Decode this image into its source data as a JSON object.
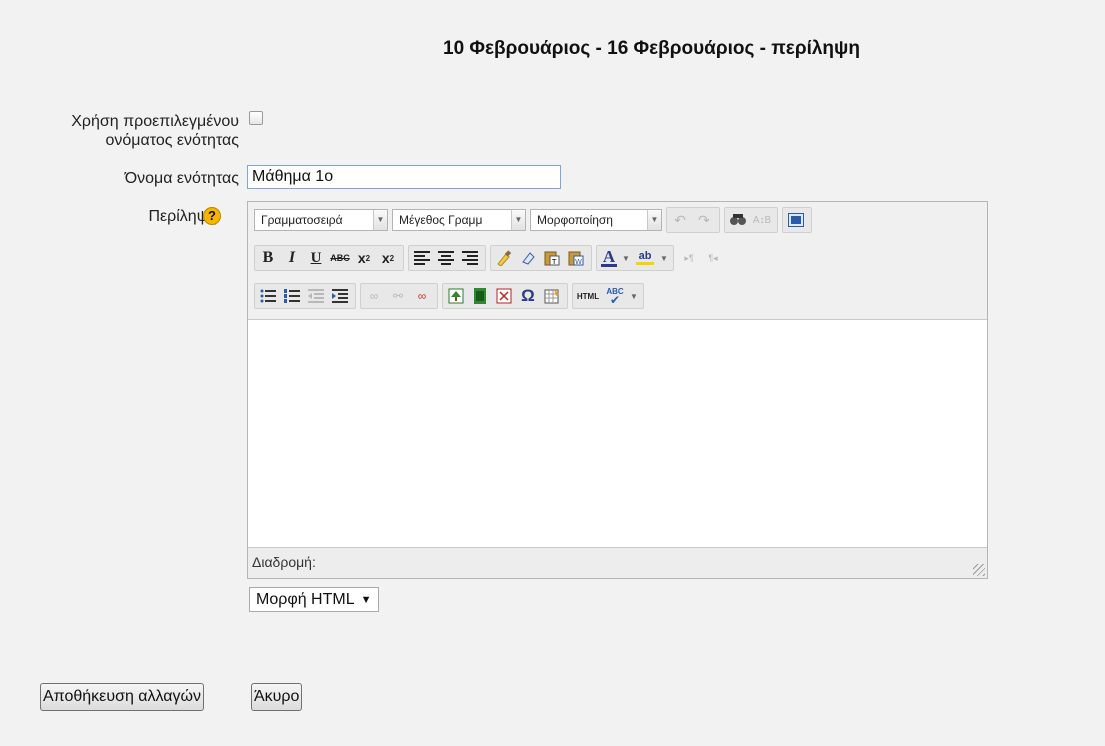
{
  "page": {
    "title": "10 Φεβρουάριος - 16 Φεβρουάριος - περίληψη"
  },
  "form": {
    "use_default_name_label_line1": "Χρήση προεπιλεγμένου",
    "use_default_name_label_line2": "ονόματος ενότητας",
    "use_default_name_checked": false,
    "section_name_label": "Όνομα ενότητας",
    "section_name_value": "Μάθημα 1ο",
    "summary_label": "Περίληψη",
    "help_icon_glyph": "?"
  },
  "editor": {
    "toolbar": {
      "font_family": "Γραμματοσειρά",
      "font_size": "Μέγεθος Γραμμ",
      "format": "Μορφοποίηση"
    },
    "path_label": "Διαδρομή:",
    "icons": [
      "undo-icon",
      "redo-icon",
      "find-icon",
      "replace-icon",
      "fullscreen-icon",
      "bold-icon",
      "italic-icon",
      "underline-icon",
      "strikethrough-icon",
      "subscript-icon",
      "superscript-icon",
      "align-left-icon",
      "align-center-icon",
      "align-right-icon",
      "clean-icon",
      "eraser-icon",
      "paste-text-icon",
      "paste-word-icon",
      "font-color-icon",
      "highlight-icon",
      "ltr-icon",
      "rtl-icon",
      "unordered-list-icon",
      "ordered-list-icon",
      "outdent-icon",
      "indent-icon",
      "link-icon",
      "unlink-icon",
      "anchor-icon",
      "image-icon",
      "media-icon",
      "emoticon-icon",
      "special-char-icon",
      "table-icon",
      "html-source-icon",
      "spellcheck-icon"
    ]
  },
  "format_select": {
    "value": "Μορφή HTML"
  },
  "buttons": {
    "save": "Αποθήκευση αλλαγών",
    "cancel": "Άκυρο"
  }
}
